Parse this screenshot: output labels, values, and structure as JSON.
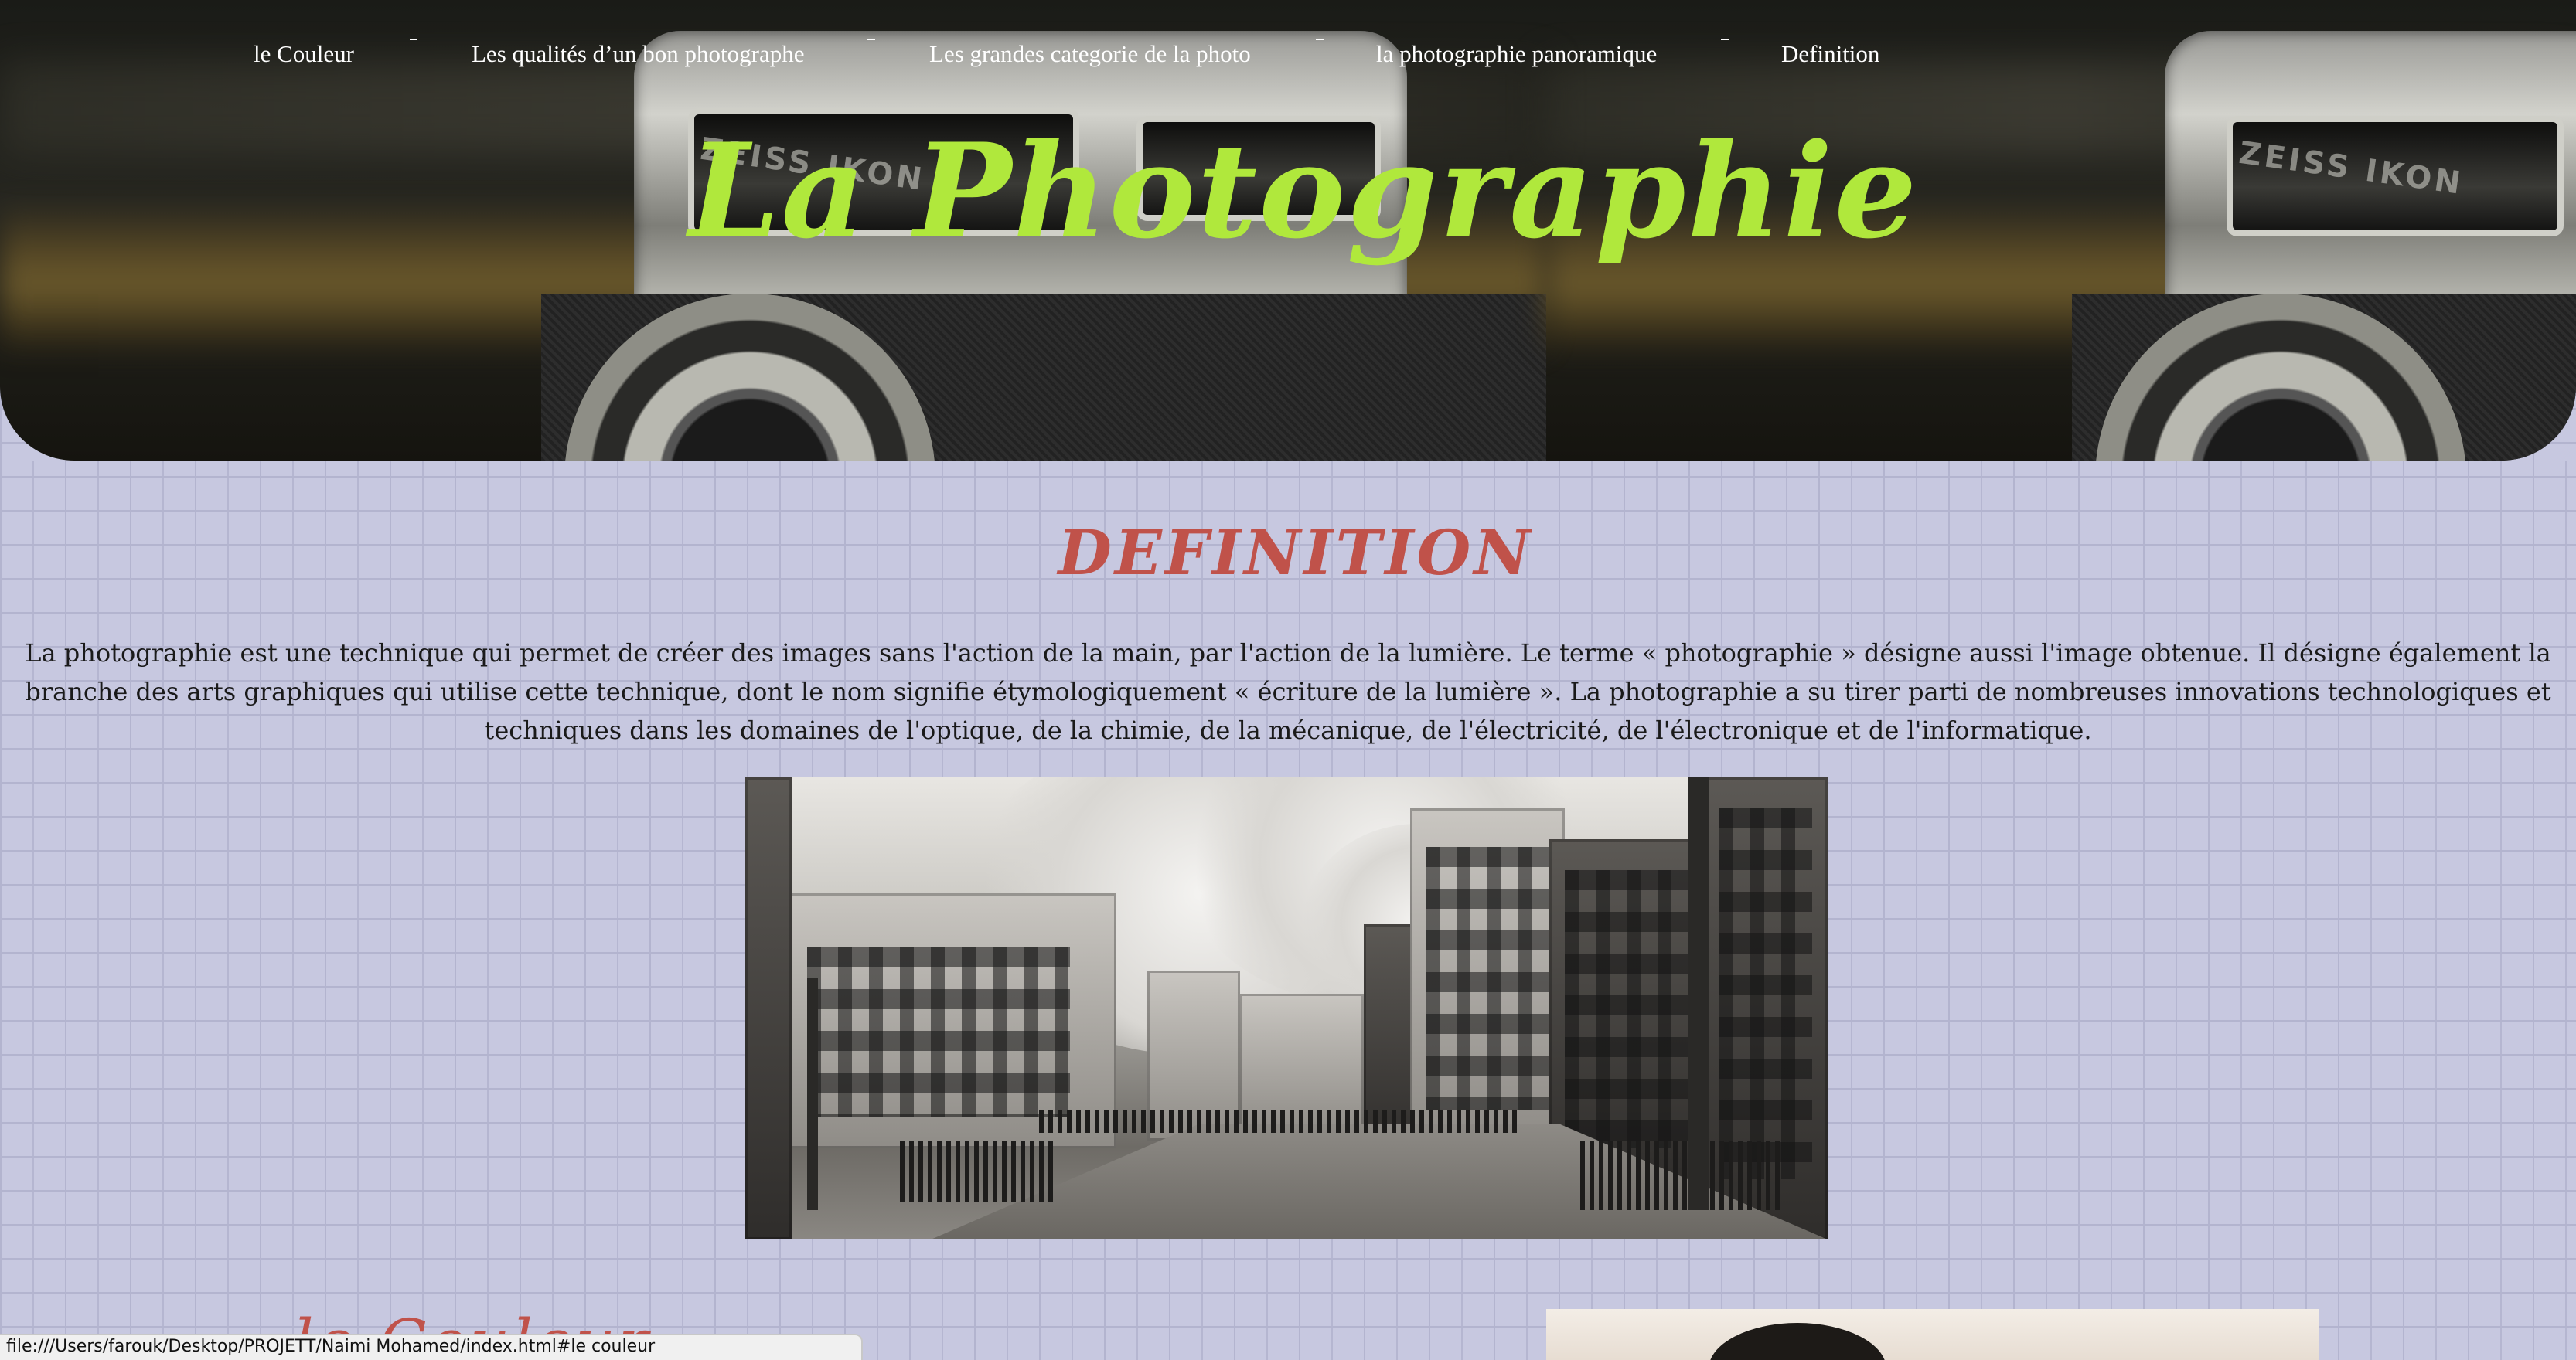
{
  "nav": {
    "items": [
      {
        "label": "le Couleur"
      },
      {
        "label": "Les qualités d’un bon photographe"
      },
      {
        "label": "Les grandes categorie de la photo"
      },
      {
        "label": "la photographie panoramique"
      },
      {
        "label": "Definition"
      }
    ]
  },
  "hero": {
    "title": "La Photographie",
    "camera_label": "ZEISS IKON"
  },
  "colors": {
    "title_green": "#b0e83c",
    "heading_red": "#c0524a",
    "background_lavender": "#c7c8e0"
  },
  "definition": {
    "title": "DEFINITION",
    "text": "La photographie est une technique qui permet de créer des images sans l'action de la main, par l'action de la lumière. Le terme « photographie » désigne aussi l'image obtenue. Il désigne également la branche des arts graphiques qui utilise cette technique, dont le nom signifie étymologiquement « écriture de la lumière ». La photographie a su tirer parti de nombreuses innovations technologiques et techniques dans les domaines de l'optique, de la chimie, de la mécanique, de l'électricité, de l'électronique et de l'informatique."
  },
  "next_section": {
    "title_partial": "le Couleur"
  },
  "status_bar": {
    "url": "file:///Users/farouk/Desktop/PROJETT/Naimi Mohamed/index.html#le couleur"
  }
}
